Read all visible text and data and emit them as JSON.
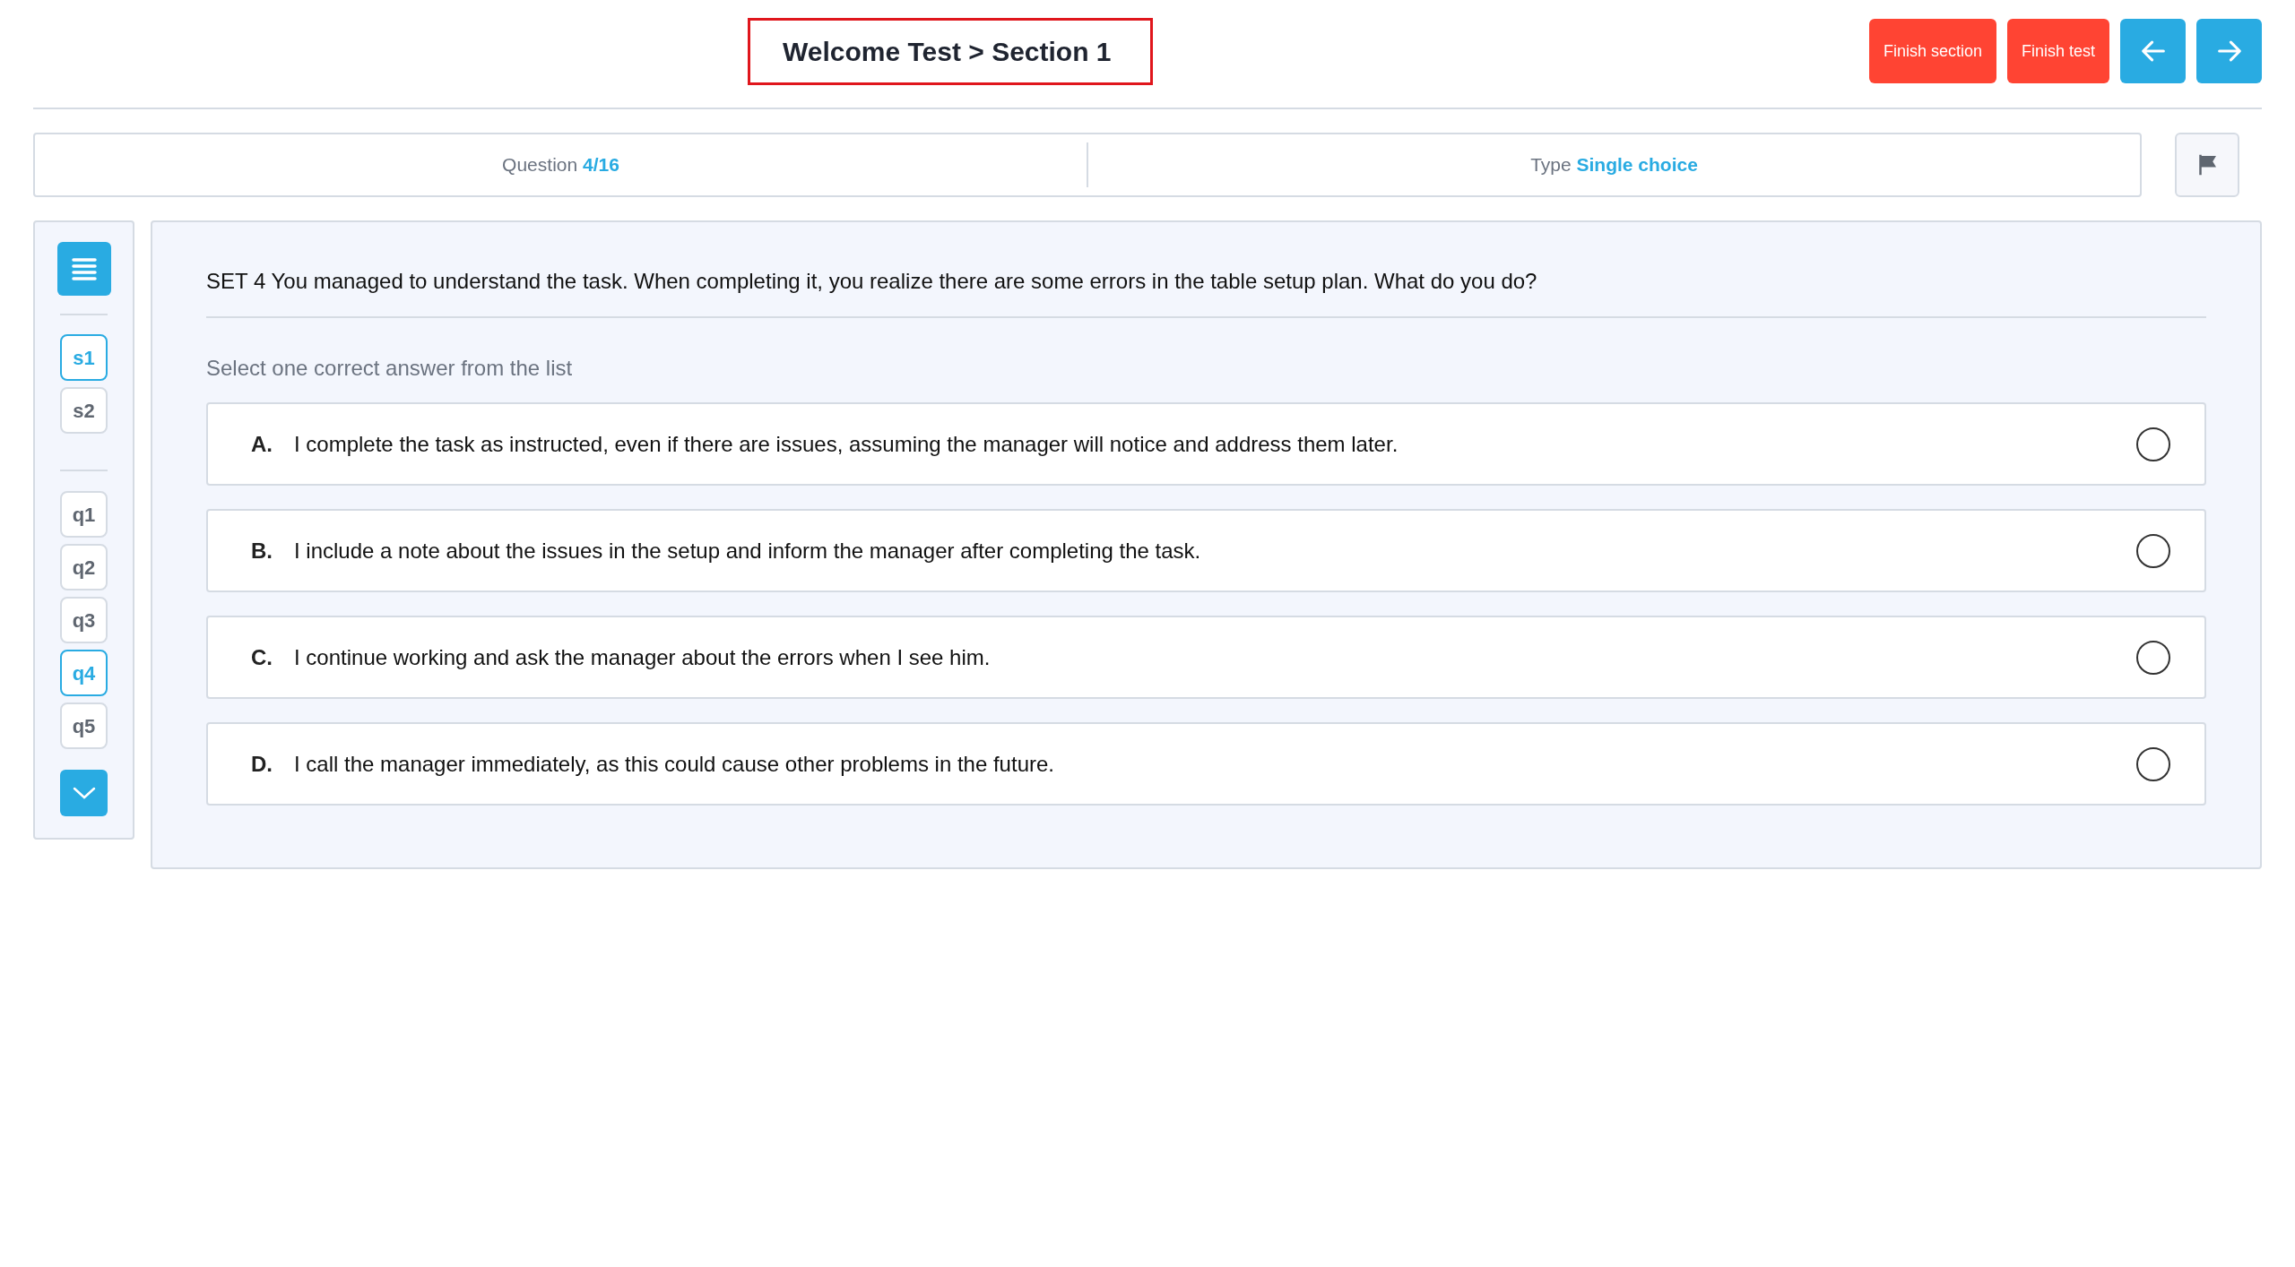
{
  "header": {
    "title": "Welcome Test > Section 1",
    "buttons": [
      {
        "label": "Finish section",
        "kind": "danger"
      },
      {
        "label": "Finish test",
        "kind": "danger"
      },
      {
        "kind": "prev"
      },
      {
        "kind": "next"
      }
    ]
  },
  "info_bar": {
    "question_label": "Question",
    "question_value": "4/16",
    "type_label": "Type",
    "type_value": "Single choice"
  },
  "sidebar": {
    "sections": [
      {
        "label": "s1",
        "selected": true
      },
      {
        "label": "s2",
        "selected": false
      }
    ],
    "questions": [
      {
        "label": "q1",
        "selected": false
      },
      {
        "label": "q2",
        "selected": false
      },
      {
        "label": "q3",
        "selected": false
      },
      {
        "label": "q4",
        "selected": true
      },
      {
        "label": "q5",
        "selected": false
      }
    ]
  },
  "question": {
    "text": "SET 4 You managed to understand the task. When completing it, you realize there are some errors in the table setup plan. What do you do?",
    "hint": "Select one correct answer from the list",
    "options": [
      {
        "letter": "A.",
        "text": "I complete the task as instructed, even if there are issues, assuming the manager will notice and address them later.",
        "selected": false
      },
      {
        "letter": "B.",
        "text": "I include a note about the issues in the setup and inform the manager after completing the task.",
        "selected": false
      },
      {
        "letter": "C.",
        "text": "I continue working and ask the manager about the errors when I see him.",
        "selected": false
      },
      {
        "letter": "D.",
        "text": "I call the manager immediately, as this could cause other problems in the future.",
        "selected": false
      }
    ]
  }
}
